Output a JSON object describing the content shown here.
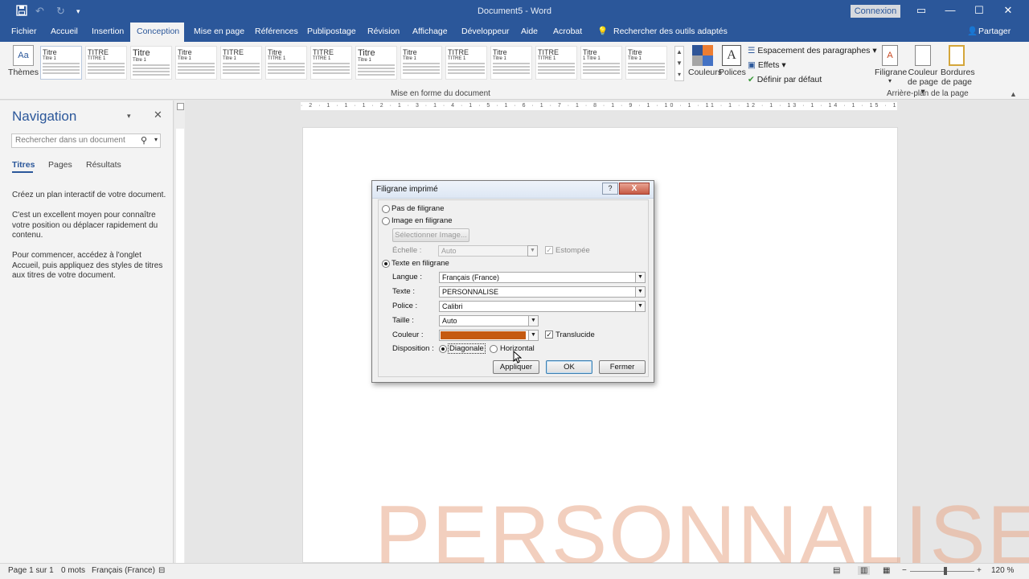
{
  "titlebar": {
    "doc_title": "Document5 - Word",
    "connexion": "Connexion",
    "save_icon": "save-icon",
    "undo_icon": "undo-icon",
    "redo_icon": "redo-icon"
  },
  "tabs": [
    "Fichier",
    "Accueil",
    "Insertion",
    "Conception",
    "Mise en page",
    "Références",
    "Publipostage",
    "Révision",
    "Affichage",
    "Développeur",
    "Aide",
    "Acrobat"
  ],
  "active_tab": "Conception",
  "tellme": "Rechercher des outils adaptés",
  "share": "Partager",
  "ribbon": {
    "themes_label": "Thèmes",
    "styles": [
      {
        "title": "Titre",
        "sub": "Titre 1"
      },
      {
        "title": "TITRE",
        "sub": "TITRE 1"
      },
      {
        "title": "Titre",
        "sub": "Titre 1"
      },
      {
        "title": "Titre",
        "sub": "Titre 1"
      },
      {
        "title": "TITRE",
        "sub": "Titre 1"
      },
      {
        "title": "Titre",
        "sub": "TITRE 1"
      },
      {
        "title": "TITRE",
        "sub": "TITRE 1"
      },
      {
        "title": "Titre",
        "sub": "Titre 1"
      },
      {
        "title": "Titre",
        "sub": "Titre 1"
      },
      {
        "title": "TITRE",
        "sub": "TITRE 1"
      },
      {
        "title": "Titre",
        "sub": "Titre 1"
      },
      {
        "title": "TITRE",
        "sub": "TITRE 1"
      },
      {
        "title": "Titre",
        "sub": "1 Titre 1"
      },
      {
        "title": "Titre",
        "sub": "Titre 1"
      }
    ],
    "group_mise_en_forme": "Mise en forme du document",
    "couleurs": "Couleurs",
    "polices": "Polices",
    "espacement": "Espacement des paragraphes",
    "effets": "Effets",
    "definir_defaut": "Définir par défaut",
    "filigrane": "Filigrane",
    "couleur_page_1": "Couleur",
    "couleur_page_2": "de page",
    "bordures_1": "Bordures",
    "bordures_2": "de page",
    "group_arriere_plan": "Arrière-plan de la page"
  },
  "navigation": {
    "title": "Navigation",
    "search_placeholder": "Rechercher dans un document",
    "tabs": [
      "Titres",
      "Pages",
      "Résultats"
    ],
    "p1": "Créez un plan interactif de votre document.",
    "p2": "C'est un excellent moyen pour connaître votre position ou déplacer rapidement du contenu.",
    "p3": "Pour commencer, accédez à l'onglet Accueil, puis appliquez des styles de titres aux titres de votre document."
  },
  "ruler": "· 2 · 1 · 1 · 1 · 2 · 1 · 3 · 1 · 4 · 1 · 5 · 1 · 6 · 1 · 7 · 1 · 8 · 1 · 9 · 1 · 10 · 1 · 11 · 1 · 12 · 1 · 13 · 1 · 14 · 1 · 15 · 1 · 16 · 1 · 17 · 1 · 18 ·",
  "watermark_text": "PERSONNALISE",
  "dialog": {
    "title": "Filigrane imprimé",
    "help": "?",
    "close": "X",
    "opt_none": "Pas de filigrane",
    "opt_image": "Image en filigrane",
    "select_image_btn": "Sélectionner Image...",
    "echelle_label": "Échelle :",
    "echelle_value": "Auto",
    "estompee": "Estompée",
    "opt_text": "Texte en filigrane",
    "langue_label": "Langue :",
    "langue_value": "Français (France)",
    "texte_label": "Texte :",
    "texte_value": "PERSONNALISE",
    "police_label": "Police :",
    "police_value": "Calibri",
    "taille_label": "Taille :",
    "taille_value": "Auto",
    "couleur_label": "Couleur :",
    "couleur_value": "#c55a11",
    "translucide": "Translucide",
    "disposition_label": "Disposition :",
    "diagonale": "Diagonale",
    "horizontal": "Horizontal",
    "appliquer": "Appliquer",
    "ok": "OK",
    "fermer": "Fermer",
    "selected_option": "text",
    "selected_layout": "diagonale"
  },
  "statusbar": {
    "page": "Page 1 sur 1",
    "words": "0 mots",
    "language": "Français (France)",
    "zoom": "120 %"
  },
  "colors": {
    "brand": "#2b579a",
    "watermark": "#e9a98a",
    "swatch": "#c55a11"
  }
}
